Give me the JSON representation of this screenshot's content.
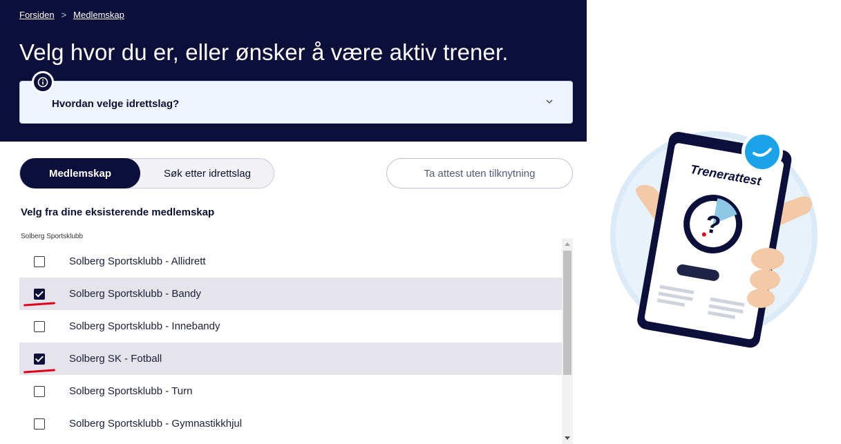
{
  "breadcrumb": {
    "home": "Forsiden",
    "separator": ">",
    "current": "Medlemskap"
  },
  "page_title": "Velg hvor du er, eller ønsker å være aktiv trener.",
  "info": {
    "question": "Hvordan velge idrettslag?",
    "icon": "info-icon",
    "toggle_icon": "chevron-down-icon"
  },
  "tabs": {
    "active": "Medlemskap",
    "inactive": "Søk etter idrettslag"
  },
  "attest_button": "Ta attest uten tilknytning",
  "section_heading": "Velg fra dine eksisterende medlemskap",
  "club_group": "Solberg Sportsklubb",
  "memberships": [
    {
      "label": "Solberg Sportsklubb - Allidrett",
      "checked": false
    },
    {
      "label": "Solberg Sportsklubb - Bandy",
      "checked": true
    },
    {
      "label": "Solberg Sportsklubb - Innebandy",
      "checked": false
    },
    {
      "label": "Solberg SK - Fotball",
      "checked": true
    },
    {
      "label": "Solberg Sportsklubb - Turn",
      "checked": false
    },
    {
      "label": "Solberg Sportsklubb - Gymnastikkhjul",
      "checked": false
    }
  ],
  "illustration": {
    "phone_text": "Trenerattest"
  },
  "colors": {
    "navy": "#0b0f3a",
    "accent_blue": "#1aa3e8",
    "annotation_red": "#e0001b"
  }
}
